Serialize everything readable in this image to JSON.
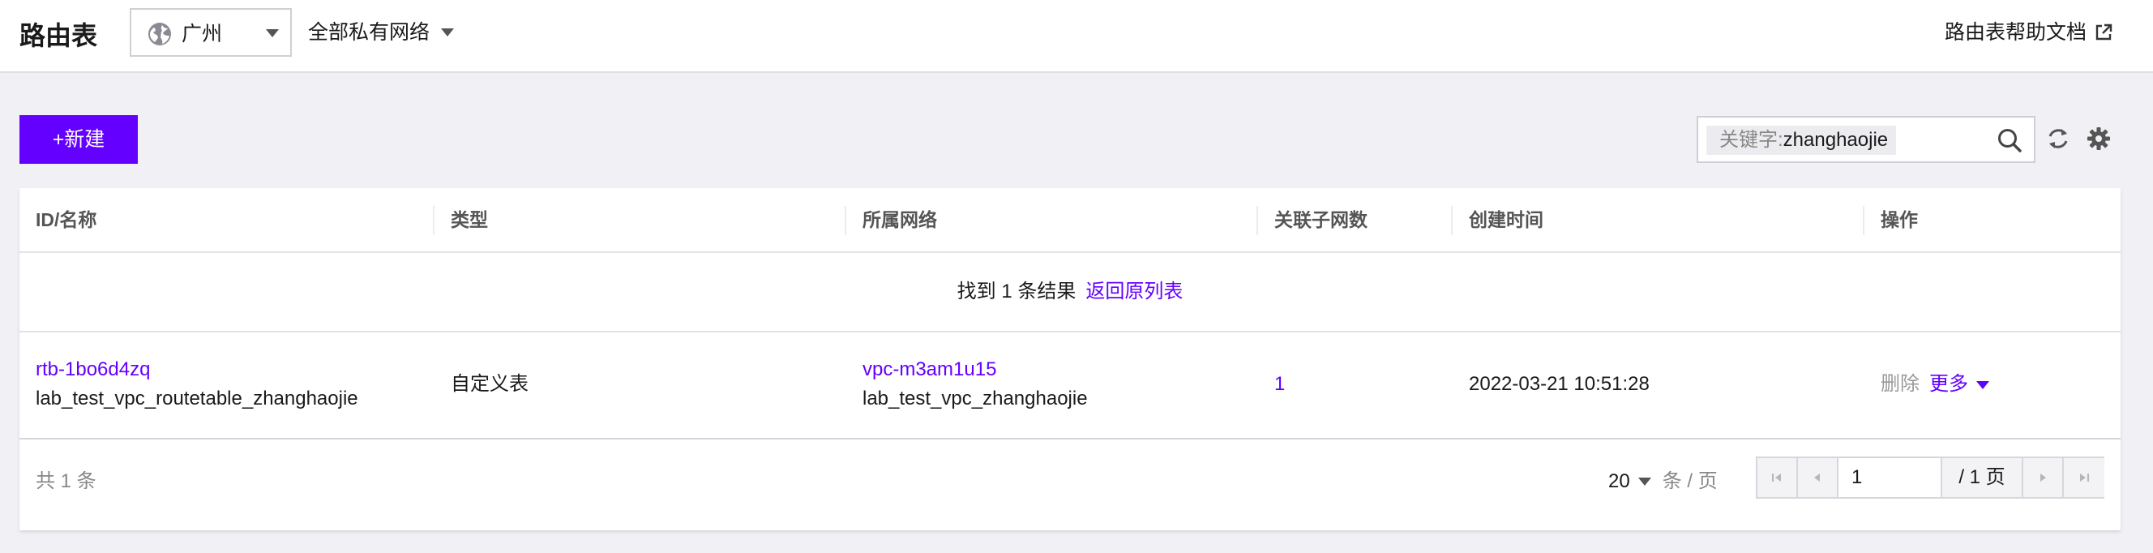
{
  "header": {
    "title": "路由表",
    "region": "广州",
    "vpc_filter": "全部私有网络",
    "help_link": "路由表帮助文档"
  },
  "toolbar": {
    "create_label": "+新建",
    "search_key": "关键字:",
    "search_value": "zhanghaojie"
  },
  "table": {
    "columns": [
      "ID/名称",
      "类型",
      "所属网络",
      "关联子网数",
      "创建时间",
      "操作"
    ],
    "result_text": "找到 1 条结果",
    "back_link": "返回原列表",
    "rows": [
      {
        "id": "rtb-1bo6d4zq",
        "name": "lab_test_vpc_routetable_zhanghaojie",
        "type": "自定义表",
        "vpc_id": "vpc-m3am1u15",
        "vpc_name": "lab_test_vpc_zhanghaojie",
        "subnet_count": "1",
        "created": "2022-03-21 10:51:28",
        "delete_label": "删除",
        "more_label": "更多"
      }
    ]
  },
  "footer": {
    "total": "共 1 条",
    "page_size": "20",
    "page_size_unit": "条 / 页",
    "current_page": "1",
    "total_pages": "/ 1 页"
  },
  "colors": {
    "accent": "#6300ff",
    "background": "#f0f0f5"
  }
}
